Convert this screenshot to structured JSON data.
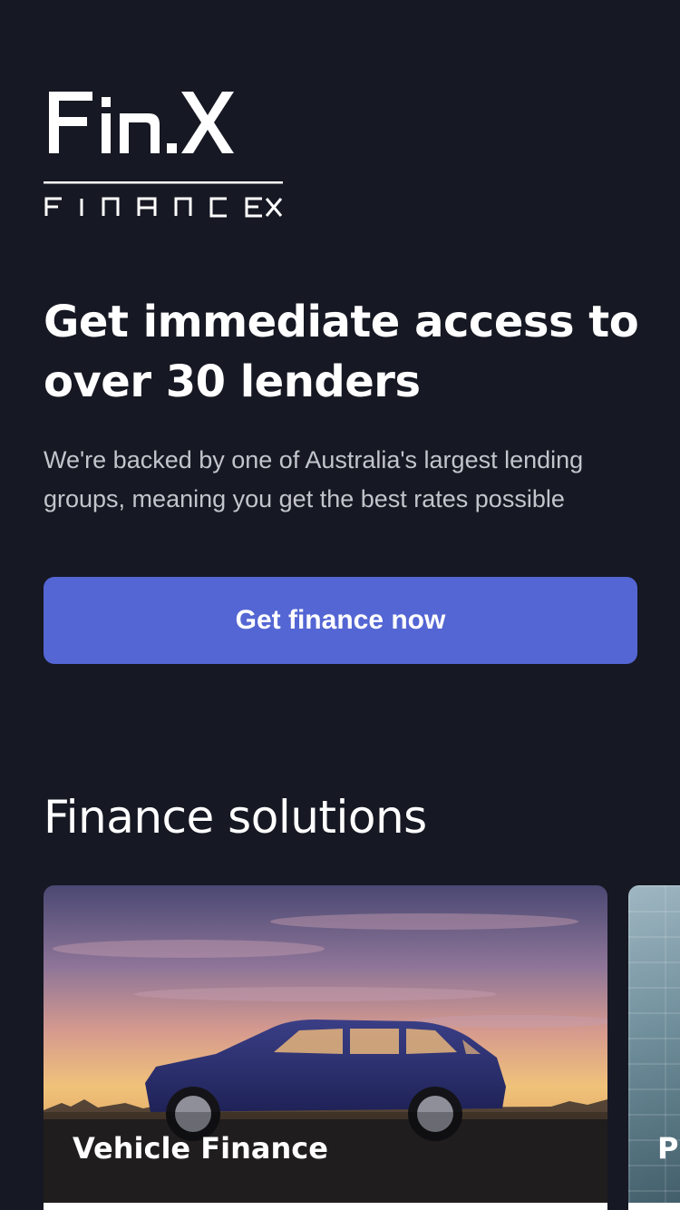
{
  "brand": {
    "logo_text": "Fin.X",
    "tagline": "FINANCE X"
  },
  "hero": {
    "headline": "Get immediate access to over 30 lenders",
    "subtext": "We're backed by one of Australia's largest lending groups, meaning you get the best rates possible",
    "cta_label": "Get finance now"
  },
  "solutions": {
    "title": "Finance solutions",
    "cards": [
      {
        "label": "Vehicle Finance",
        "image": "blue-station-wagon-at-sunset"
      },
      {
        "label": "P",
        "image": "blue-tiled-wall"
      }
    ]
  },
  "colors": {
    "background": "#161823",
    "accent": "#5466d3",
    "text_primary": "#ffffff",
    "text_secondary": "#c3c5cc"
  }
}
